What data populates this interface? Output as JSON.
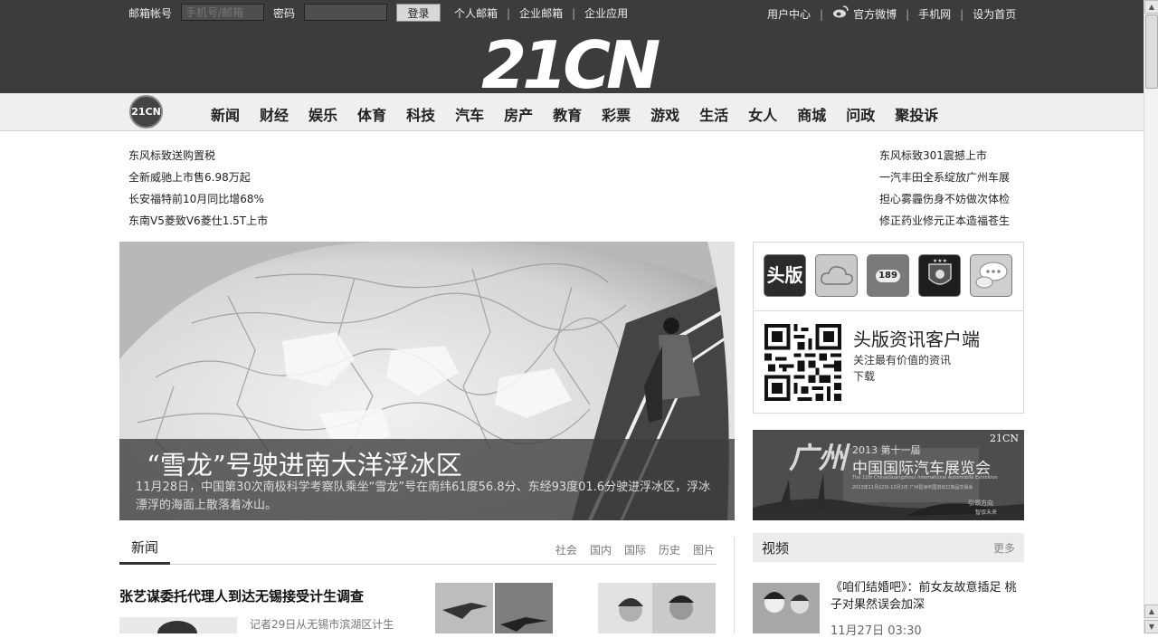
{
  "topbar": {
    "account_label": "邮箱帐号",
    "account_placeholder": "手机号/邮箱",
    "password_label": "密码",
    "login_button": "登录",
    "left_links": [
      "个人邮箱",
      "企业邮箱",
      "企业应用"
    ],
    "right_links": [
      "用户中心",
      "官方微博",
      "手机网",
      "设为首页"
    ]
  },
  "logo": "21CN",
  "nav": {
    "badge": "21CN",
    "items": [
      "新闻",
      "财经",
      "娱乐",
      "体育",
      "科技",
      "汽车",
      "房产",
      "教育",
      "彩票",
      "游戏",
      "生活",
      "女人",
      "商城",
      "问政",
      "聚投诉"
    ]
  },
  "ads_left": [
    "东风标致送购置税",
    "全新威驰上市售6.98万起",
    "长安福特前10月同比增68%",
    "东南V5菱致V6菱仕1.5T上市"
  ],
  "ads_right": [
    "东风标致301震撼上市",
    "一汽丰田全系绽放广州车展",
    "担心雾霾伤身不妨做次体检",
    "修正药业修元正本造福苍生"
  ],
  "hero": {
    "title": "“雪龙”号驶进南大洋浮冰区",
    "desc": "11月28日，中国第30次南极科学考察队乘坐“雪龙”号在南纬61度56.8分、东经93度01.6分驶进浮冰区，浮冰漂浮的海面上散落着冰山。"
  },
  "apps": {
    "icons": [
      {
        "name": "toutiao-app-icon",
        "label": "头版"
      },
      {
        "name": "cloud-app-icon",
        "label": ""
      },
      {
        "name": "cloud189-app-icon",
        "label": "189"
      },
      {
        "name": "football-club-app-icon",
        "label": ""
      },
      {
        "name": "chat-app-icon",
        "label": ""
      }
    ],
    "client_title": "头版资讯客户端",
    "client_subtitle": "关注最有价值的资讯",
    "download": "下载"
  },
  "banner": {
    "brand": "21CN",
    "city": "广州",
    "edition": "2013 第十一届",
    "headline": "中国国际汽车展览会",
    "english": "The 11th China(Guangzhou) International Automobile Exhibition",
    "dates": "2013年11月22日-12月1日 广州琶洲中国进出口商品交易会",
    "slogan_1": "引领方向",
    "slogan_2": "智驭未来"
  },
  "news": {
    "tab": "新闻",
    "links": [
      "社会",
      "国内",
      "国际",
      "历史",
      "图片"
    ],
    "headline": "张艺谋委托代理人到达无锡接受计生调查",
    "snippet": "记者29日从无锡市滨湖区计生"
  },
  "video": {
    "title": "视频",
    "more": "更多",
    "item_title": "《咱们结婚吧》：前女友故意插足 桃子对果然误会加深",
    "item_date": "11月27日 03:30"
  },
  "colors": {
    "dark_band": "#3c3c3c",
    "nav_bg": "#efefef",
    "panel_border": "#d8d8d8"
  }
}
